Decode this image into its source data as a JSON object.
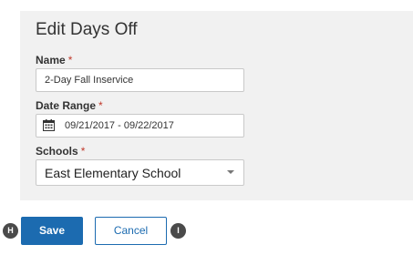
{
  "form": {
    "title": "Edit Days Off",
    "name": {
      "label": "Name",
      "required_mark": "*",
      "value": "2-Day Fall Inservice"
    },
    "date_range": {
      "label": "Date Range",
      "required_mark": "*",
      "value": "09/21/2017 - 09/22/2017",
      "icon": "calendar-icon"
    },
    "schools": {
      "label": "Schools",
      "required_mark": "*",
      "selected": "East Elementary School",
      "icon": "chevron-down-icon"
    }
  },
  "actions": {
    "save_label": "Save",
    "cancel_label": "Cancel"
  },
  "hotkeys": {
    "save": "H",
    "cancel": "I"
  },
  "colors": {
    "primary": "#1c6bb0",
    "panel_bg": "#f1f1f1",
    "required": "#c0392b"
  }
}
